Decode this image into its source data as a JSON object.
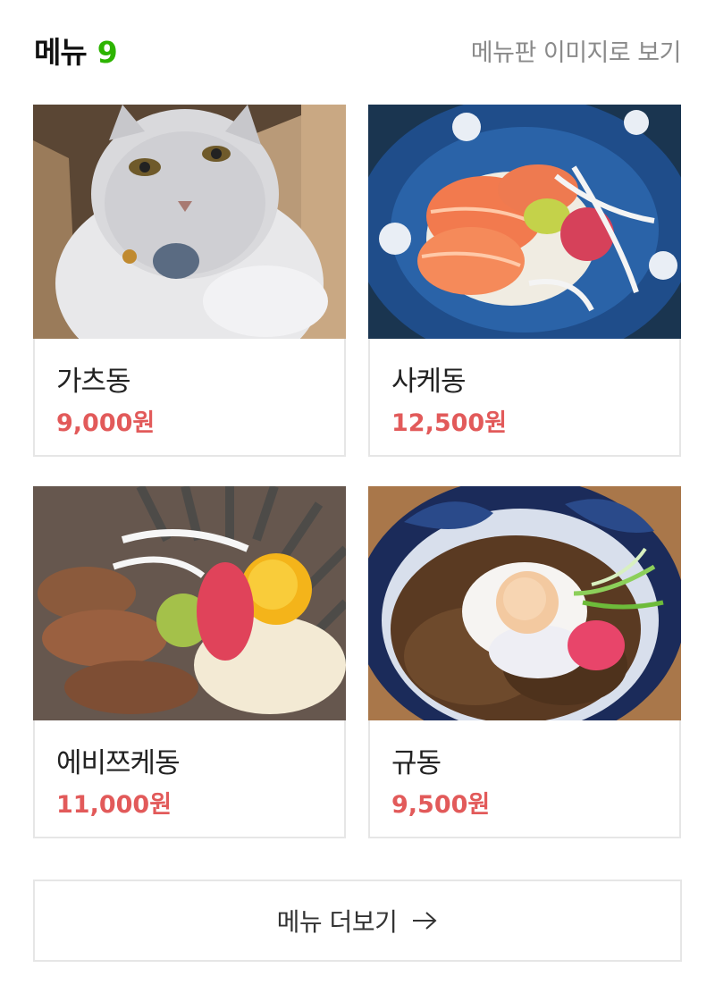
{
  "header": {
    "title": "메뉴",
    "count": "9",
    "view_as_image": "메뉴판 이미지로 보기"
  },
  "menu_items": [
    {
      "name": "가츠동",
      "price": "9,000원",
      "image": "cat-in-box-photo"
    },
    {
      "name": "사케동",
      "price": "12,500원",
      "image": "salmon-rice-bowl-photo"
    },
    {
      "name": "에비쯔케동",
      "price": "11,000원",
      "image": "shrimp-rice-bowl-photo"
    },
    {
      "name": "규동",
      "price": "9,500원",
      "image": "beef-rice-bowl-photo"
    }
  ],
  "more_button": {
    "label": "메뉴 더보기",
    "icon": "arrow-right-icon"
  },
  "colors": {
    "accent_green": "#2db400",
    "price_red": "#e25a5a",
    "muted_text": "#8a8a8a",
    "border": "#e6e6e6"
  }
}
